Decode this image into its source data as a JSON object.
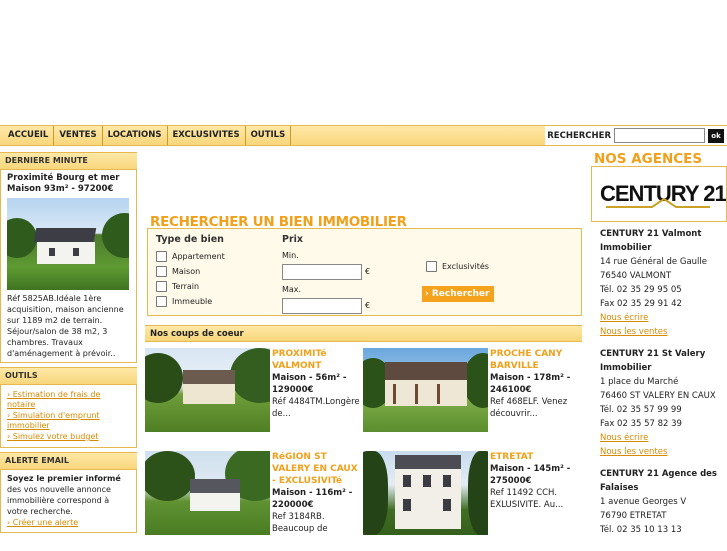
{
  "nav": {
    "items": [
      "ACCUEIL",
      "VENTES",
      "LOCATIONS",
      "EXCLUSIVITES",
      "OUTILS"
    ],
    "search_label": "RECHERCHER",
    "ok_label": "ok"
  },
  "last_minute": {
    "header": "DERNIERE MINUTE",
    "title": "Proximité Bourg et mer Maison 93m² - 97200€",
    "desc": "Réf 5825AB.Idéale 1ère acquisition, maison ancienne sur 1189 m2 de terrain. Séjour/salon de 38 m2, 3 chambres. Travaux d'aménagement à prévoir.."
  },
  "tools": {
    "header": "OUTILS",
    "links": [
      "Estimation de frais de notaire",
      "Simulation d'emprunt immobilier",
      "Simulez votre budget"
    ]
  },
  "alert": {
    "header": "ALERTE EMAIL",
    "bold": "Soyez le premier informé",
    "text": " des vos nouvelle annonce immobilière correspond à votre recherche.",
    "link": "Créer une alerte"
  },
  "search": {
    "title": "RECHERCHER UN BIEN IMMOBILIER",
    "type_header": "Type de bien",
    "types": [
      "Appartement",
      "Maison",
      "Terrain",
      "Immeuble"
    ],
    "price_header": "Prix",
    "min_label": "Min.",
    "max_label": "Max.",
    "currency": "€",
    "exclusive_label": "Exclusivités",
    "button": "Rechercher"
  },
  "favorites": {
    "header": "Nos coups de coeur",
    "items": [
      {
        "title": "PROXIMITé VALMONT",
        "sub": "Maison - 56m² - 129000€",
        "desc": "Réf 4484TM.Longère de..."
      },
      {
        "title": "PROCHE CANY BARVILLE",
        "sub": "Maison - 178m² - 246100€",
        "desc": "Ref 468ELF. Venez découvrir..."
      },
      {
        "title": "RéGION ST VALERY EN CAUX - EXCLUSIVITé",
        "sub": "Maison - 116m² - 220000€",
        "desc": "Ref 3184RB. Beaucoup de"
      },
      {
        "title": "ETRETAT",
        "sub": "Maison - 145m² - 275000€",
        "desc": "Ref 11492 CCH. EXLUSIVITE. Au..."
      }
    ]
  },
  "agencies": {
    "title": "NOS AGENCES",
    "logo_text": "CENTURY 21",
    "items": [
      {
        "name": "CENTURY 21 Valmont Immobilier",
        "addr1": "14 rue Général de Gaulle",
        "addr2": "76540 VALMONT",
        "tel": "Tél. 02 35 29 95 05",
        "fax": "Fax 02 35 29 91 42",
        "write": "Nous écrire",
        "sales": "Nous les ventes"
      },
      {
        "name": "CENTURY 21 St Valery Immobilier",
        "addr1": "1 place du Marché",
        "addr2": "76460 ST VALERY EN CAUX",
        "tel": "Tél. 02 35 57 99 99",
        "fax": "Fax 02 35 57 82 39",
        "write": "Nous écrire",
        "sales": "Nous les ventes"
      },
      {
        "name": "CENTURY 21 Agence des Falaises",
        "addr1": "1 avenue Georges V",
        "addr2": "76790 ETRETAT",
        "tel": "Tél. 02 35 10 13 13"
      }
    ]
  }
}
